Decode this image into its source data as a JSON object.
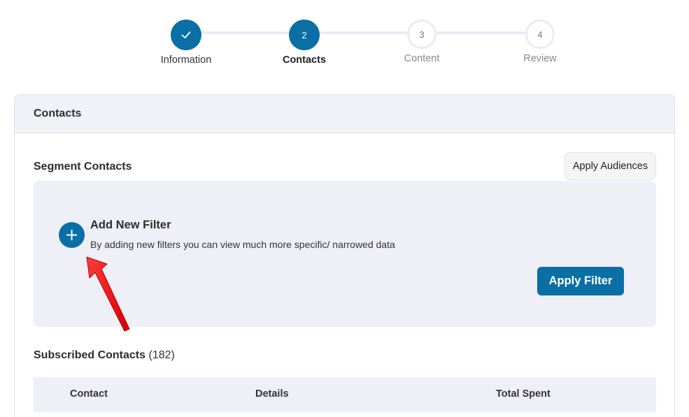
{
  "stepper": {
    "steps": [
      {
        "label": "Information",
        "number": "",
        "status": "done"
      },
      {
        "label": "Contacts",
        "number": "2",
        "status": "active"
      },
      {
        "label": "Content",
        "number": "3",
        "status": "pending"
      },
      {
        "label": "Review",
        "number": "4",
        "status": "pending"
      }
    ]
  },
  "card": {
    "title": "Contacts",
    "segment": {
      "title": "Segment Contacts",
      "apply_audiences_label": "Apply Audiences",
      "add_filter_icon": "plus-icon",
      "add_filter_title": "Add New Filter",
      "add_filter_description": "By adding new filters you can view much more specific/ narrowed data",
      "apply_filter_label": "Apply Filter"
    },
    "subscribed": {
      "title": "Subscribed Contacts",
      "count": "(182)"
    },
    "table": {
      "columns": [
        "Contact",
        "Details",
        "Total Spent"
      ]
    }
  },
  "colors": {
    "accent": "#0a6fa5",
    "panel": "#efeff8",
    "annotation_arrow": "#ff1a1a"
  }
}
